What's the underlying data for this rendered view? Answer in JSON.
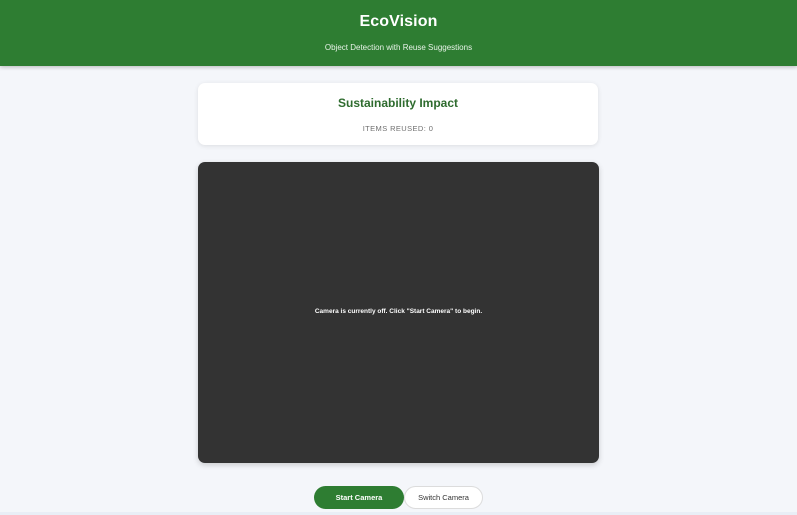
{
  "header": {
    "title": "EcoVision",
    "subtitle": "Object Detection with Reuse Suggestions"
  },
  "impact": {
    "title": "Sustainability Impact",
    "items_reused_label": "ITEMS REUSED: 0"
  },
  "camera": {
    "off_message": "Camera is currently off. Click \"Start Camera\" to begin."
  },
  "controls": {
    "start_label": "Start Camera",
    "switch_label": "Switch Camera"
  },
  "colors": {
    "brand_green": "#2e7d32",
    "heading_green": "#2e6b2e",
    "camera_bg": "#333333",
    "page_bg": "#f4f6fa"
  }
}
